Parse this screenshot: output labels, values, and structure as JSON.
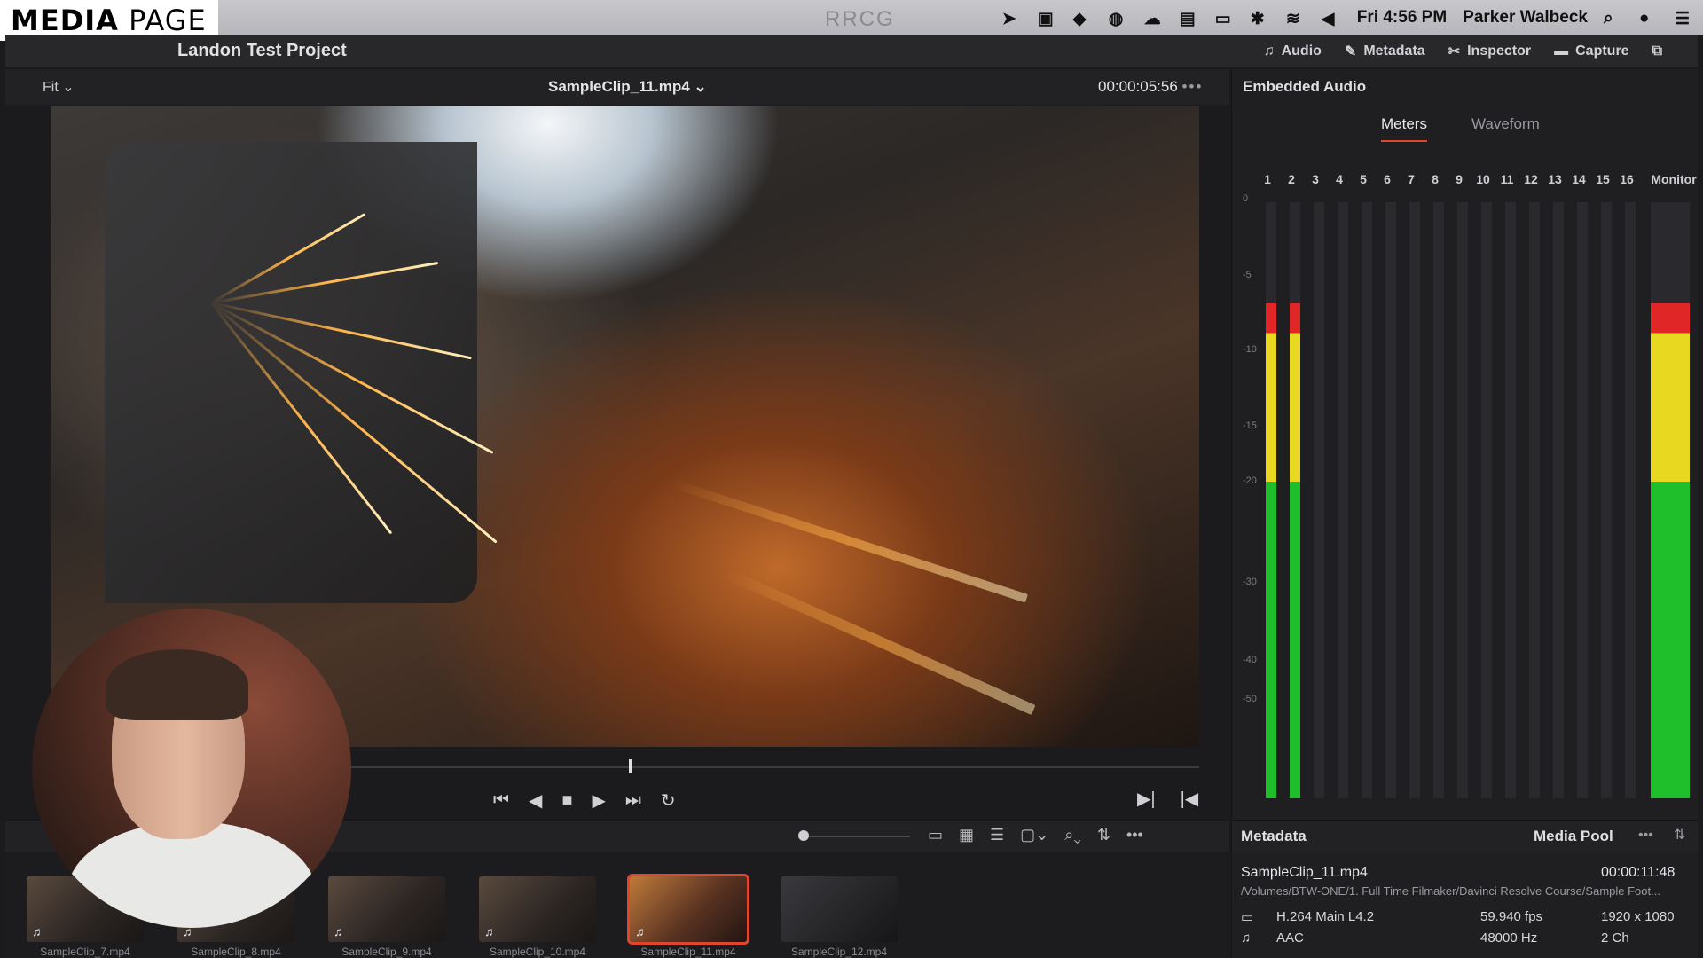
{
  "overlay_label": {
    "bold": "MEDIA",
    "rest": " PAGE"
  },
  "menubar": {
    "clock": "Fri 4:56 PM",
    "user": "Parker Walbeck",
    "watermark": "RRCG"
  },
  "titlebar": {
    "project": "Landon Test Project",
    "tools": [
      {
        "icon": "music-note-icon",
        "label": "Audio"
      },
      {
        "icon": "metadata-icon",
        "label": "Metadata"
      },
      {
        "icon": "inspector-icon",
        "label": "Inspector"
      },
      {
        "icon": "capture-icon",
        "label": "Capture"
      }
    ]
  },
  "viewer": {
    "fit": "Fit",
    "clip": "SampleClip_11.mp4",
    "timecode": "00:00:05:56"
  },
  "audio": {
    "title": "Embedded Audio",
    "tabs": [
      "Meters",
      "Waveform"
    ],
    "active_tab": "Meters",
    "channels": [
      "1",
      "2",
      "3",
      "4",
      "5",
      "6",
      "7",
      "8",
      "9",
      "10",
      "11",
      "12",
      "13",
      "14",
      "15",
      "16"
    ],
    "monitor_label": "Monitor",
    "scale": [
      "0",
      "-5",
      "-10",
      "-15",
      "-20",
      "-30",
      "-40",
      "-50"
    ],
    "levels": {
      "ch1": 0.83,
      "ch2": 0.83,
      "monitor": 0.83
    },
    "colors": {
      "green": "#1fbf2c",
      "yellow": "#e8d820",
      "red": "#e02626"
    }
  },
  "metadata": {
    "title": "Metadata",
    "pool_title": "Media Pool",
    "clip_name": "SampleClip_11.mp4",
    "duration": "00:00:11:48",
    "path": "/Volumes/BTW-ONE/1. Full Time Filmaker/Davinci Resolve Course/Sample Foot...",
    "video_codec": "H.264 Main L4.2",
    "fps": "59.940 fps",
    "resolution": "1920 x 1080",
    "audio_codec": "AAC",
    "sample_rate": "48000 Hz",
    "channels": "2 Ch"
  },
  "thumbnails": [
    {
      "label": "SampleClip_7.mp4",
      "selected": false
    },
    {
      "label": "SampleClip_8.mp4",
      "selected": false
    },
    {
      "label": "SampleClip_9.mp4",
      "selected": false
    },
    {
      "label": "SampleClip_10.mp4",
      "selected": false
    },
    {
      "label": "SampleClip_11.mp4",
      "selected": true
    },
    {
      "label": "SampleClip_12.mp4",
      "selected": false
    }
  ],
  "accent": "#e0452e"
}
